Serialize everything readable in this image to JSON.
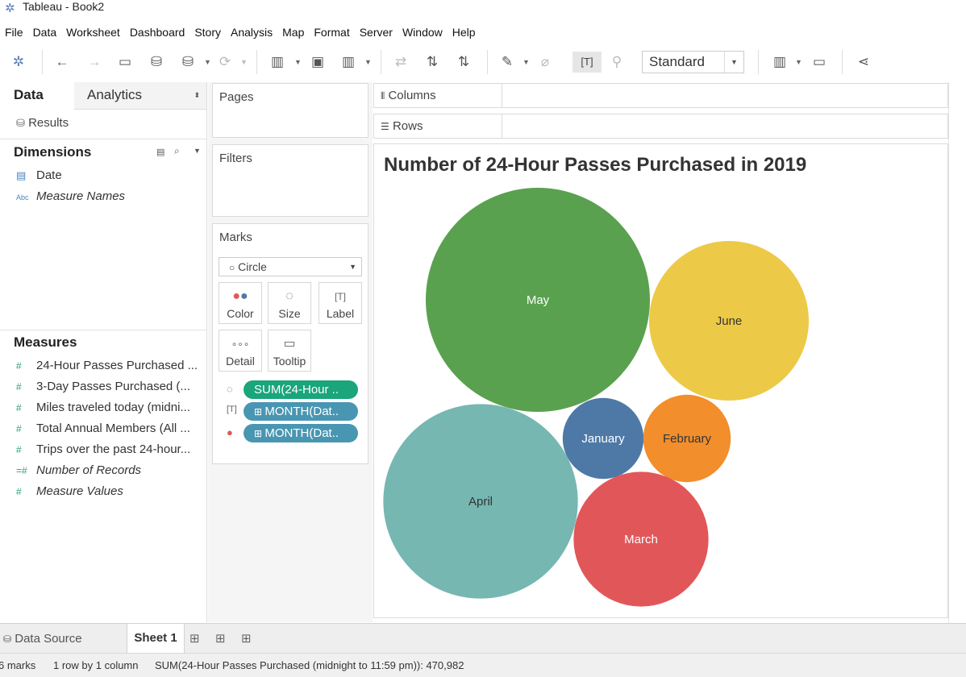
{
  "window": {
    "title": "Tableau - Book2"
  },
  "menu": [
    "File",
    "Data",
    "Worksheet",
    "Dashboard",
    "Story",
    "Analysis",
    "Map",
    "Format",
    "Server",
    "Window",
    "Help"
  ],
  "toolbar": {
    "fit_select": "Standard"
  },
  "data_pane": {
    "tab_data": "Data",
    "tab_analytics": "Analytics",
    "datasource": "Results",
    "dimensions_title": "Dimensions",
    "dimensions": [
      {
        "icon": "calendar-icon",
        "label": "Date",
        "italic": false
      },
      {
        "icon": "abc-icon",
        "label": "Measure Names",
        "italic": true
      }
    ],
    "measures_title": "Measures",
    "measures": [
      {
        "label": "24-Hour Passes Purchased ...",
        "italic": false
      },
      {
        "label": "3-Day Passes Purchased (...",
        "italic": false
      },
      {
        "label": "Miles traveled today (midni...",
        "italic": false
      },
      {
        "label": "Total Annual Members (All ...",
        "italic": false
      },
      {
        "label": "Trips over the past 24-hour...",
        "italic": false
      },
      {
        "label": "Number of Records",
        "italic": true
      },
      {
        "label": "Measure Values",
        "italic": true
      }
    ]
  },
  "cards": {
    "pages": "Pages",
    "filters": "Filters",
    "marks": "Marks",
    "mark_type": "Circle",
    "mark_buttons": [
      "Color",
      "Size",
      "Label",
      "Detail",
      "Tooltip"
    ],
    "pills": [
      {
        "icon": "size-icon",
        "label": "SUM(24-Hour ..",
        "color": "#1aa57a"
      },
      {
        "icon": "label-icon",
        "label": "MONTH(Dat..",
        "color": "#4996b2"
      },
      {
        "icon": "color-icon",
        "label": "MONTH(Dat..",
        "color": "#4996b2"
      }
    ]
  },
  "shelves": {
    "columns": "Columns",
    "rows": "Rows"
  },
  "chart_data": {
    "type": "packed-bubble",
    "title": "Number of 24-Hour Passes Purchased in 2019",
    "measure": "SUM(24-Hour Passes Purchased (midnight to 11:59 pm))",
    "categories": [
      "May",
      "June",
      "January",
      "February",
      "April",
      "March"
    ],
    "values": [
      138000,
      70000,
      18000,
      21000,
      104000,
      50000
    ],
    "colors": [
      "#59a14f",
      "#edc948",
      "#4e79a7",
      "#f28e2b",
      "#76b7b2",
      "#e15759"
    ],
    "label_colors": [
      "#ffffff",
      "#333333",
      "#ffffff",
      "#333333",
      "#333333",
      "#ffffff"
    ],
    "total": "470,982"
  },
  "tabs": {
    "data_source": "Data Source",
    "sheet": "Sheet 1"
  },
  "status": {
    "marks": "6 marks",
    "dims": "1 row by 1 column",
    "sum": "SUM(24-Hour Passes Purchased (midnight to 11:59 pm)): 470,982"
  }
}
